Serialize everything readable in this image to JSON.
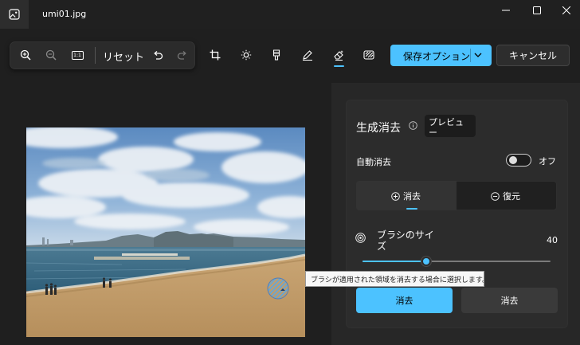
{
  "titlebar": {
    "file_name": "umi01.jpg",
    "app_icon": "photo-icon",
    "buttons": [
      "minimize-icon",
      "maximize-icon",
      "close-icon"
    ]
  },
  "toolbar": {
    "zoom_in_icon": "zoom-in-icon",
    "zoom_out_icon": "zoom-out-icon",
    "actual_size_label": "1:1",
    "reset_label": "リセット",
    "undo_icon": "undo-icon",
    "redo_icon": "redo-icon",
    "tools": [
      "crop-icon",
      "brightness-icon",
      "filter-icon",
      "markup-icon",
      "erase-icon",
      "background-icon"
    ],
    "active_tool": "erase-icon",
    "save_label": "保存オプション",
    "cancel_label": "キャンセル"
  },
  "panel": {
    "title": "生成消去",
    "preview_badge": "プレビュー",
    "auto_erase_label": "自動消去",
    "auto_erase_state": "オフ",
    "auto_erase_on": false,
    "mode_erase_label": "消去",
    "mode_restore_label": "復元",
    "active_mode": "消去",
    "brush_size_label": "ブラシのサイズ",
    "brush_size_value": "40",
    "brush_size_fraction": 0.34,
    "erase_button_label": "消去",
    "erase_button2_label": "消去",
    "tooltip": "ブラシが適用された領域を消去する場合に選択します。"
  },
  "colors": {
    "accent": "#4cc2ff",
    "background": "#1f1f1f",
    "panel": "#2c2c2c"
  }
}
